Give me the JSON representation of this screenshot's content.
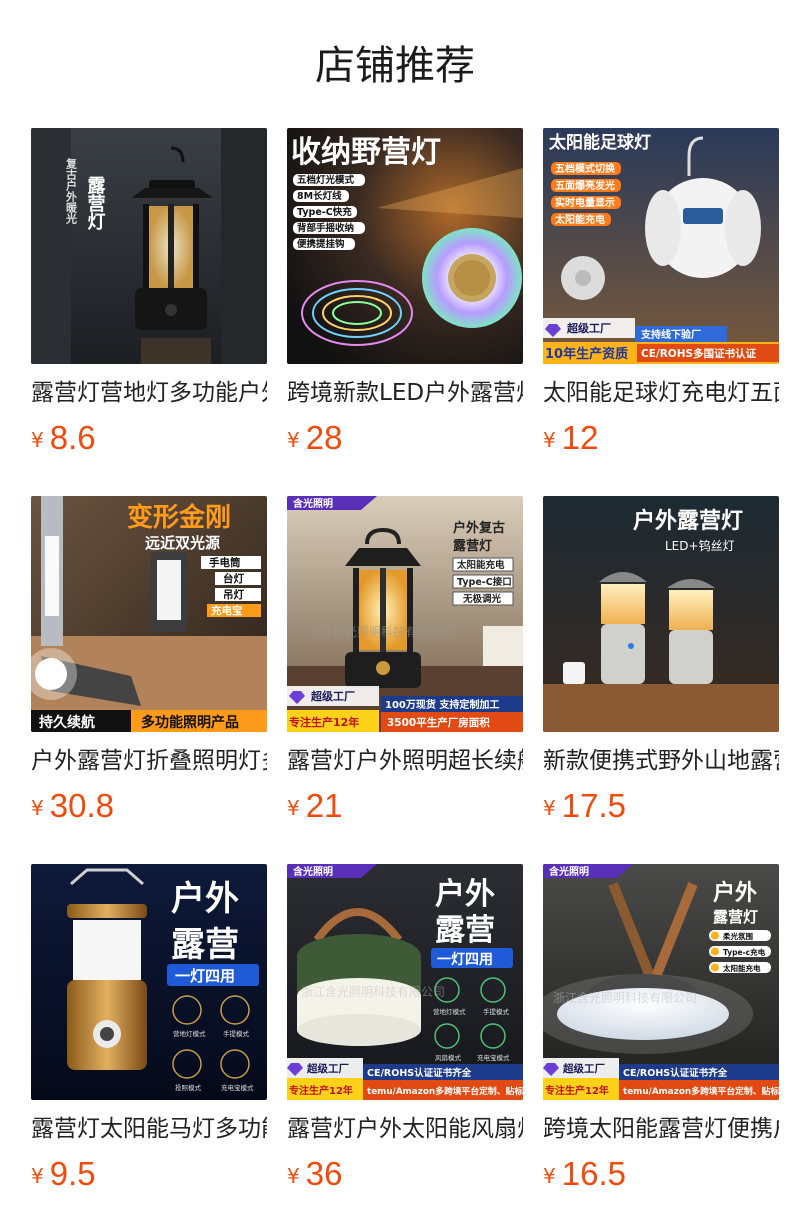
{
  "page": {
    "title": "店铺推荐"
  },
  "products": [
    {
      "name": "露营灯营地灯多功能户外照明复古马灯",
      "currency": "¥",
      "price": "8.6",
      "image": {
        "texts": [
          "复古户外暖光",
          "露营灯"
        ]
      }
    },
    {
      "name": "跨境新款LED户外露营灯带收纳野营灯",
      "currency": "¥",
      "price": "28",
      "image": {
        "texts": [
          "收纳野营灯",
          "五档灯光模式",
          "8M长灯线",
          "Type-C快充",
          "背部手摇收纳",
          "便携提挂钩"
        ]
      }
    },
    {
      "name": "太阳能足球灯充电灯五面爆亮发光",
      "currency": "¥",
      "price": "12",
      "image": {
        "texts": [
          "太阳能足球灯",
          "五档模式切换",
          "五面爆亮发光",
          "实时电量显示",
          "太阳能充电",
          "超级工厂",
          "支持线下验厂",
          "10年生产资质",
          "CE/ROHS多国证书认证"
        ]
      }
    },
    {
      "name": "户外露营灯折叠照明灯多功能手电筒",
      "currency": "¥",
      "price": "30.8",
      "image": {
        "texts": [
          "变形金刚",
          "远近双光源",
          "手电筒",
          "台灯",
          "吊灯",
          "充电宝",
          "持久续航",
          "多功能照明产品"
        ]
      }
    },
    {
      "name": "露营灯户外照明超长续航复古露营灯",
      "currency": "¥",
      "price": "21",
      "image": {
        "texts": [
          "含光照明",
          "户外复古",
          "露营灯",
          "太阳能充电",
          "Type-C接口",
          "无极调光",
          "超级工厂",
          "专注生产12年",
          "100万现货 支持定制加工",
          "3500平生产厂房面积",
          "浙江含光照明科技有限公司"
        ]
      }
    },
    {
      "name": "新款便携式野外山地露营灯钨丝灯",
      "currency": "¥",
      "price": "17.5",
      "image": {
        "texts": [
          "户外露营灯",
          "LED+钨丝灯"
        ]
      }
    },
    {
      "name": "露营灯太阳能马灯多功能一灯四用",
      "currency": "¥",
      "price": "9.5",
      "image": {
        "texts": [
          "户外",
          "露营",
          "一灯四用",
          "营地灯模式",
          "手提模式",
          "投照模式",
          "充电宝模式"
        ]
      }
    },
    {
      "name": "露营灯户外太阳能风扇灯一灯四用",
      "currency": "¥",
      "price": "36",
      "image": {
        "texts": [
          "含光照明",
          "户外",
          "露营",
          "一灯四用",
          "营地灯模式",
          "手提模式",
          "风扇模式",
          "充电宝模式",
          "超级工厂",
          "专注生产12年",
          "CE/ROHS认证证书齐全",
          "temu/Amazon多跨境平台定制、贴标",
          "浙江含光照明科技有限公司"
        ]
      }
    },
    {
      "name": "跨境太阳能露营灯便携户外照明灯",
      "currency": "¥",
      "price": "16.5",
      "image": {
        "texts": [
          "含光照明",
          "户外",
          "露营灯",
          "柔光氛围",
          "Type-c充电",
          "太阳能充电",
          "超级工厂",
          "专注生产12年",
          "CE/ROHS认证证书齐全",
          "temu/Amazon多跨境平台定制、贴标",
          "浙江含光照明科技有限公司"
        ]
      }
    }
  ],
  "colors": {
    "price": "#f04a0c",
    "title": "#1b1b1b",
    "text": "#222222"
  }
}
